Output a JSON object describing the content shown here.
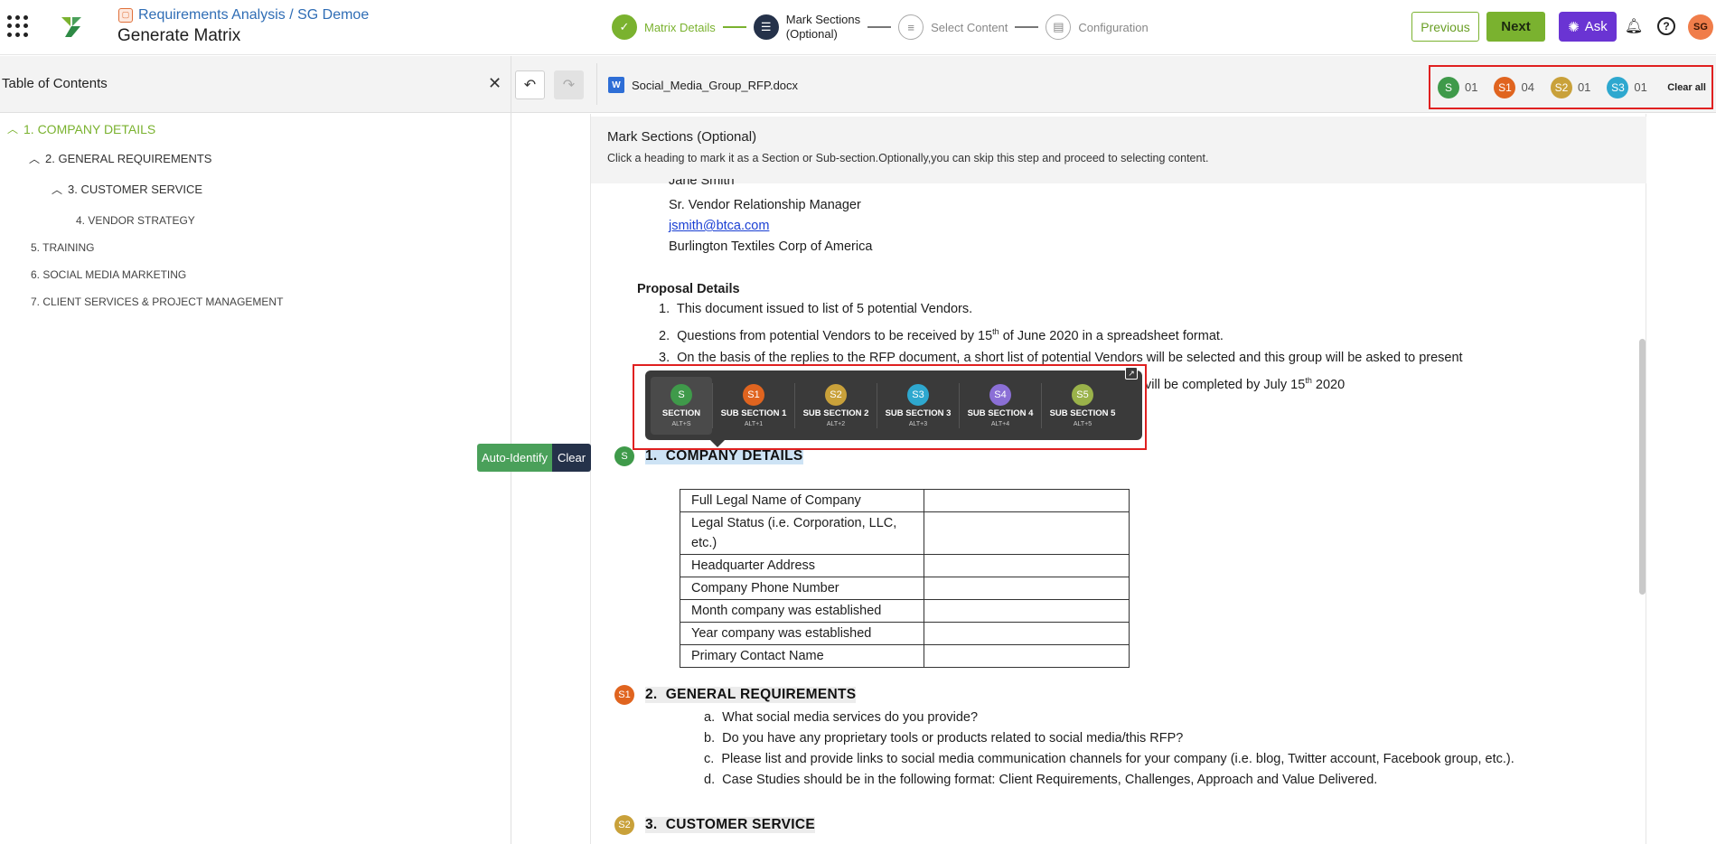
{
  "header": {
    "breadcrumb": "Requirements Analysis / SG Demoe",
    "title": "Generate Matrix",
    "steps": [
      {
        "label": "Matrix Details",
        "state": "done"
      },
      {
        "label": "Mark Sections",
        "label2": "(Optional)",
        "state": "active"
      },
      {
        "label": "Select Content",
        "state": "pending"
      },
      {
        "label": "Configuration",
        "state": "pending"
      }
    ],
    "previous": "Previous",
    "next": "Next",
    "ask": "Ask",
    "avatar_initials": "SG"
  },
  "toc": {
    "title": "Table of Contents",
    "items": [
      {
        "label": "1. COMPANY DETAILS"
      },
      {
        "label": "2. GENERAL REQUIREMENTS"
      },
      {
        "label": "3. CUSTOMER SERVICE"
      },
      {
        "label": "4. VENDOR STRATEGY"
      },
      {
        "label": "5. TRAINING"
      },
      {
        "label": "6. SOCIAL MEDIA MARKETING"
      },
      {
        "label": "7. CLIENT SERVICES & PROJECT MANAGEMENT"
      }
    ]
  },
  "toolbar": {
    "file_name": "Social_Media_Group_RFP.docx",
    "word_icon_letter": "W",
    "counts": [
      {
        "badge": "S",
        "count": "01",
        "color": "#3f9a4a"
      },
      {
        "badge": "S1",
        "count": "04",
        "color": "#e0641f"
      },
      {
        "badge": "S2",
        "count": "01",
        "color": "#c9a13a"
      },
      {
        "badge": "S3",
        "count": "01",
        "color": "#2ea8cf"
      }
    ],
    "clear_all": "Clear all"
  },
  "banner": {
    "title": "Mark Sections (Optional)",
    "description": "Click a heading to mark it as a Section or Sub-section.Optionally,you can skip this step and proceed to selecting content."
  },
  "document": {
    "contact": [
      "Jane Smith",
      "Sr. Vendor Relationship Manager",
      "jsmith@btca.com",
      "Burlington Textiles Corp of America"
    ],
    "proposal_heading": "Proposal Details",
    "proposal_items": [
      "This document issued to list of 5 potential Vendors.",
      "Questions from potential Vendors to be received by 15",
      "th",
      "of June 2020 in a spreadsheet format.",
      "On the basis of the replies to the RFP document, a short list of potential Vendors will be selected and this group will be asked to present",
      "vill be completed by July 15",
      "th",
      "2020"
    ],
    "numbers": [
      "1.",
      "2.",
      "3."
    ],
    "sec1": {
      "badge": "S",
      "num": "1.",
      "title": "COMPANY DETAILS"
    },
    "table_rows": [
      "Full Legal Name of Company",
      "Legal Status (i.e. Corporation, LLC,",
      "etc.)",
      "Headquarter Address",
      "Company Phone Number",
      "Month company was established",
      "Year company was established",
      "Primary Contact Name"
    ],
    "sec2": {
      "badge": "S1",
      "num": "2.",
      "title": "GENERAL REQUIREMENTS"
    },
    "sec2_items": [
      {
        "letter": "a.",
        "text": "What social media services do you provide?"
      },
      {
        "letter": "b.",
        "text": "Do you have any proprietary tools or products related to social media/this RFP?"
      },
      {
        "letter": "c.",
        "text": "Please list and provide links to social media communication channels for your company (i.e. blog, Twitter account, Facebook group, etc.)."
      },
      {
        "letter": "d.",
        "text": "Case Studies should be in the following format: Client Requirements, Challenges, Approach and Value Delivered."
      }
    ],
    "sec3": {
      "badge": "S2",
      "num": "3.",
      "title": "CUSTOMER SERVICE"
    }
  },
  "popup": {
    "options": [
      {
        "badge": "S",
        "label": "SECTION",
        "key": "ALT+S",
        "color": "#3f9a4a"
      },
      {
        "badge": "S1",
        "label": "SUB SECTION 1",
        "key": "ALT+1",
        "color": "#e0641f"
      },
      {
        "badge": "S2",
        "label": "SUB SECTION 2",
        "key": "ALT+2",
        "color": "#c9a13a"
      },
      {
        "badge": "S3",
        "label": "SUB SECTION 3",
        "key": "ALT+3",
        "color": "#2ea8cf"
      },
      {
        "badge": "S4",
        "label": "SUB SECTION 4",
        "key": "ALT+4",
        "color": "#8b6fd6"
      },
      {
        "badge": "S5",
        "label": "SUB SECTION 5",
        "key": "ALT+5",
        "color": "#9ab24a"
      }
    ]
  },
  "auto_identify": {
    "label": "Auto-Identify",
    "clear": "Clear"
  }
}
